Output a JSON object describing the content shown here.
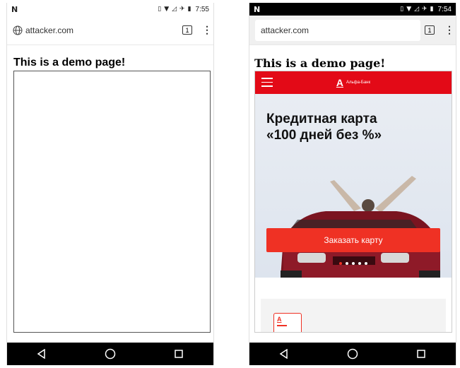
{
  "left_screen": {
    "status": {
      "left_icon": "N",
      "time": "7:55"
    },
    "url": "attacker.com",
    "tab_count": "1",
    "menu": "⋮",
    "page_title": "This is a demo page!"
  },
  "right_screen": {
    "status": {
      "left_icon": "N",
      "time": "7:54"
    },
    "url": "attacker.com",
    "tab_count": "1",
    "menu": "⋮",
    "page_title": "This is a demo page!",
    "bank": {
      "logo_glyph": "А",
      "logo_name": "Альфа-Банк",
      "hero_line1": "Кредитная карта",
      "hero_line2": "«100 дней без %»",
      "order_button": "Заказать карту",
      "card_icon_glyph": "А"
    }
  },
  "colors": {
    "bank_red": "#e30a17",
    "button_red": "#ef3124"
  },
  "icons": [
    "globe-icon",
    "tabs-icon",
    "overflow-menu-icon",
    "back-icon",
    "home-icon",
    "recents-icon",
    "hamburger-icon",
    "vibrate-icon",
    "wifi-icon",
    "no-signal-icon",
    "airplane-icon",
    "battery-icon"
  ]
}
